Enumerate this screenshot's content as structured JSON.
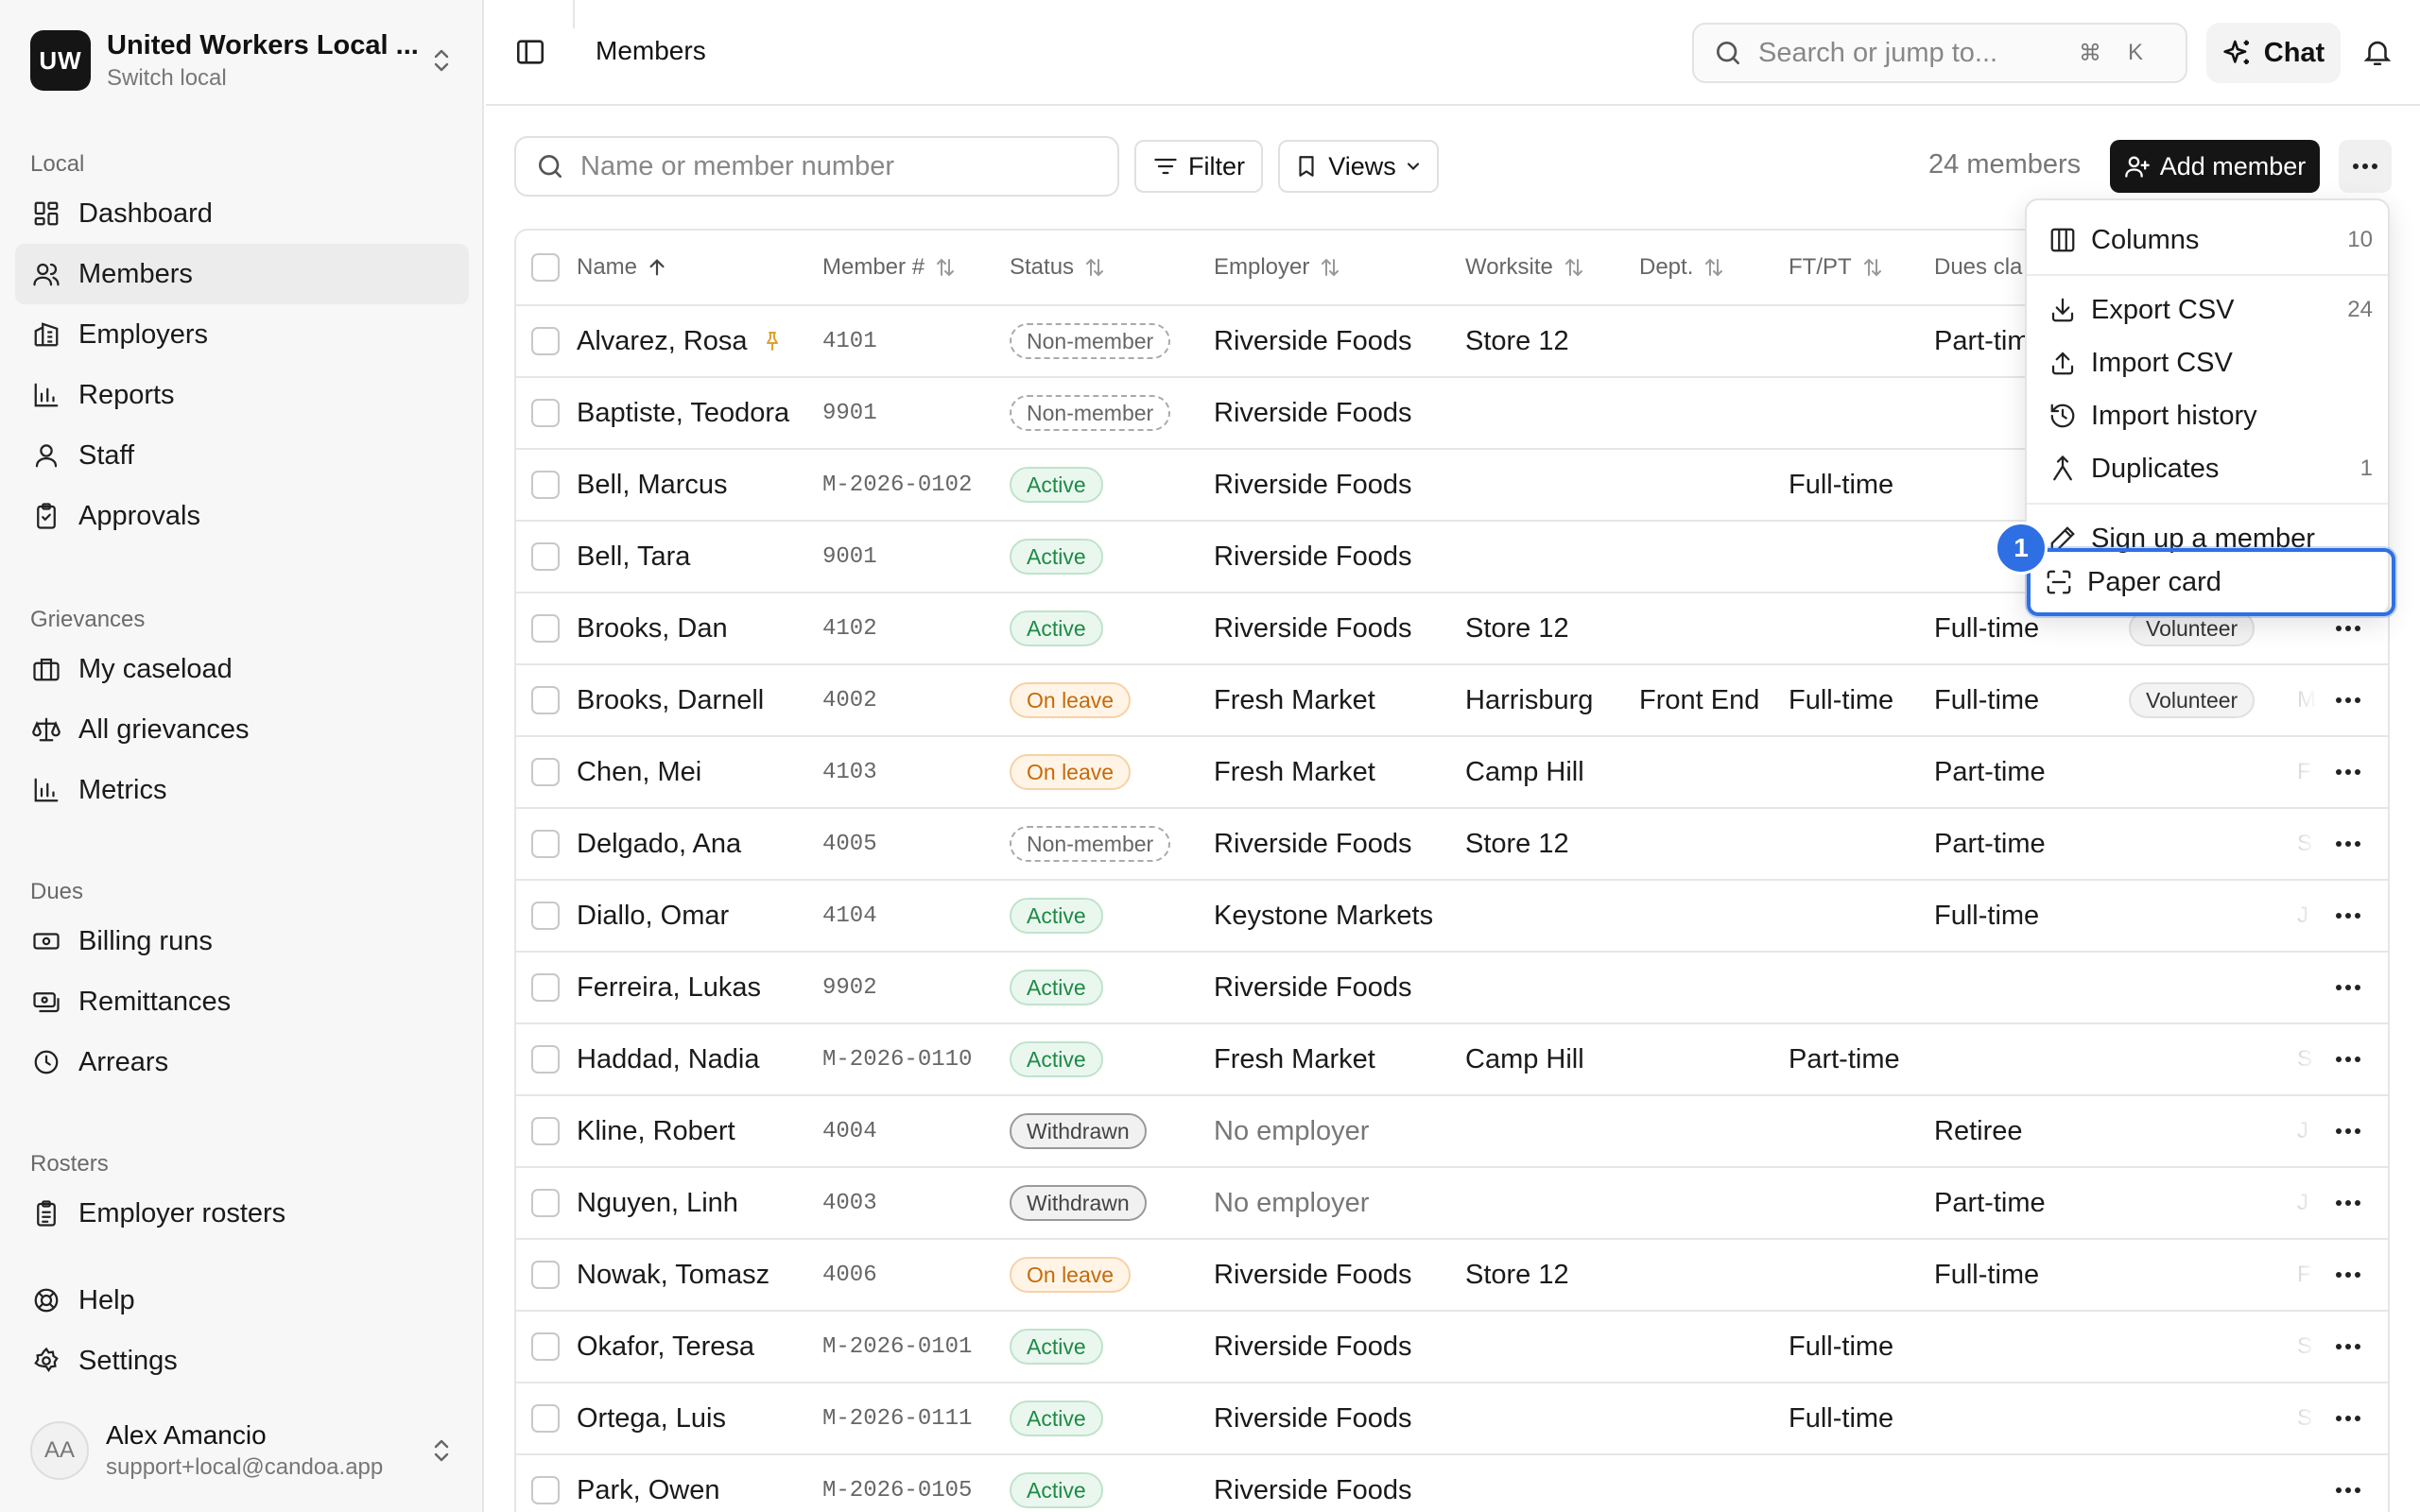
{
  "org": {
    "initials": "UW",
    "name": "United Workers Local ...",
    "subtitle": "Switch local"
  },
  "nav": {
    "local": {
      "heading": "Local",
      "items": [
        "Dashboard",
        "Members",
        "Employers",
        "Reports",
        "Staff",
        "Approvals"
      ]
    },
    "grievances": {
      "heading": "Grievances",
      "items": [
        "My caseload",
        "All grievances",
        "Metrics"
      ]
    },
    "dues": {
      "heading": "Dues",
      "items": [
        "Billing runs",
        "Remittances",
        "Arrears"
      ]
    },
    "rosters": {
      "heading": "Rosters",
      "items": [
        "Employer rosters"
      ]
    },
    "footer": [
      "Help",
      "Settings"
    ]
  },
  "user": {
    "initials": "AA",
    "name": "Alex Amancio",
    "email": "support+local@candoa.app"
  },
  "topbar": {
    "title": "Members",
    "search_placeholder": "Search or jump to...",
    "kbd_cmd": "⌘",
    "kbd_key": "K",
    "chat": "Chat"
  },
  "toolbar": {
    "search_placeholder": "Name or member number",
    "filter": "Filter",
    "views": "Views",
    "count": "24 members",
    "add": "Add member"
  },
  "table": {
    "headers": {
      "name": "Name",
      "member": "Member #",
      "status": "Status",
      "employer": "Employer",
      "worksite": "Worksite",
      "dept": "Dept.",
      "ftpt": "FT/PT",
      "dues": "Dues cla"
    },
    "rows": [
      {
        "name": "Alvarez, Rosa",
        "num": "4101",
        "status": "Non-member",
        "employer": "Riverside Foods",
        "worksite": "Store 12",
        "dept": "",
        "ftpt": "",
        "dues": "Part-tim",
        "tag": "",
        "trail": ""
      },
      {
        "name": "Baptiste, Teodora",
        "num": "9901",
        "status": "Non-member",
        "employer": "Riverside Foods",
        "worksite": "",
        "dept": "",
        "ftpt": "",
        "dues": "",
        "tag": "",
        "trail": ""
      },
      {
        "name": "Bell, Marcus",
        "num": "M-2026-0102",
        "status": "Active",
        "employer": "Riverside Foods",
        "worksite": "",
        "dept": "",
        "ftpt": "Full-time",
        "dues": "",
        "tag": "",
        "trail": ""
      },
      {
        "name": "Bell, Tara",
        "num": "9001",
        "status": "Active",
        "employer": "Riverside Foods",
        "worksite": "",
        "dept": "",
        "ftpt": "",
        "dues": "",
        "tag": "",
        "trail": ""
      },
      {
        "name": "Brooks, Dan",
        "num": "4102",
        "status": "Active",
        "employer": "Riverside Foods",
        "worksite": "Store 12",
        "dept": "",
        "ftpt": "",
        "dues": "Full-time",
        "tag": "Volunteer",
        "trail": ""
      },
      {
        "name": "Brooks, Darnell",
        "num": "4002",
        "status": "On leave",
        "employer": "Fresh Market",
        "worksite": "Harrisburg",
        "dept": "Front End",
        "ftpt": "Full-time",
        "dues": "Full-time",
        "tag": "Volunteer",
        "trail": "M"
      },
      {
        "name": "Chen, Mei",
        "num": "4103",
        "status": "On leave",
        "employer": "Fresh Market",
        "worksite": "Camp Hill",
        "dept": "",
        "ftpt": "",
        "dues": "Part-time",
        "tag": "",
        "trail": "F"
      },
      {
        "name": "Delgado, Ana",
        "num": "4005",
        "status": "Non-member",
        "employer": "Riverside Foods",
        "worksite": "Store 12",
        "dept": "",
        "ftpt": "",
        "dues": "Part-time",
        "tag": "",
        "trail": "S"
      },
      {
        "name": "Diallo, Omar",
        "num": "4104",
        "status": "Active",
        "employer": "Keystone Markets",
        "worksite": "",
        "dept": "",
        "ftpt": "",
        "dues": "Full-time",
        "tag": "",
        "trail": "J"
      },
      {
        "name": "Ferreira, Lukas",
        "num": "9902",
        "status": "Active",
        "employer": "Riverside Foods",
        "worksite": "",
        "dept": "",
        "ftpt": "",
        "dues": "",
        "tag": "",
        "trail": ""
      },
      {
        "name": "Haddad, Nadia",
        "num": "M-2026-0110",
        "status": "Active",
        "employer": "Fresh Market",
        "worksite": "Camp Hill",
        "dept": "",
        "ftpt": "Part-time",
        "dues": "",
        "tag": "",
        "trail": "S"
      },
      {
        "name": "Kline, Robert",
        "num": "4004",
        "status": "Withdrawn",
        "employer": "No employer",
        "worksite": "",
        "dept": "",
        "ftpt": "",
        "dues": "Retiree",
        "tag": "",
        "trail": "J"
      },
      {
        "name": "Nguyen, Linh",
        "num": "4003",
        "status": "Withdrawn",
        "employer": "No employer",
        "worksite": "",
        "dept": "",
        "ftpt": "",
        "dues": "Part-time",
        "tag": "",
        "trail": "J"
      },
      {
        "name": "Nowak, Tomasz",
        "num": "4006",
        "status": "On leave",
        "employer": "Riverside Foods",
        "worksite": "Store 12",
        "dept": "",
        "ftpt": "",
        "dues": "Full-time",
        "tag": "",
        "trail": "F"
      },
      {
        "name": "Okafor, Teresa",
        "num": "M-2026-0101",
        "status": "Active",
        "employer": "Riverside Foods",
        "worksite": "",
        "dept": "",
        "ftpt": "Full-time",
        "dues": "",
        "tag": "",
        "trail": "S"
      },
      {
        "name": "Ortega, Luis",
        "num": "M-2026-0111",
        "status": "Active",
        "employer": "Riverside Foods",
        "worksite": "",
        "dept": "",
        "ftpt": "Full-time",
        "dues": "",
        "tag": "",
        "trail": "S"
      },
      {
        "name": "Park, Owen",
        "num": "M-2026-0105",
        "status": "Active",
        "employer": "Riverside Foods",
        "worksite": "",
        "dept": "",
        "ftpt": "",
        "dues": "",
        "tag": "",
        "trail": ""
      }
    ]
  },
  "menu": {
    "columns": {
      "label": "Columns",
      "count": "10"
    },
    "export": {
      "label": "Export CSV",
      "count": "24"
    },
    "import": {
      "label": "Import CSV"
    },
    "history": {
      "label": "Import history"
    },
    "duplicates": {
      "label": "Duplicates",
      "count": "1"
    },
    "signup": {
      "label": "Sign up a member"
    },
    "paper": {
      "label": "Paper card"
    },
    "marker": "1"
  },
  "colors": {
    "focus": "#2f6fe4",
    "active_badge": "#1e8a47",
    "leave_badge": "#c66a0a",
    "pin": "#e0a030"
  }
}
